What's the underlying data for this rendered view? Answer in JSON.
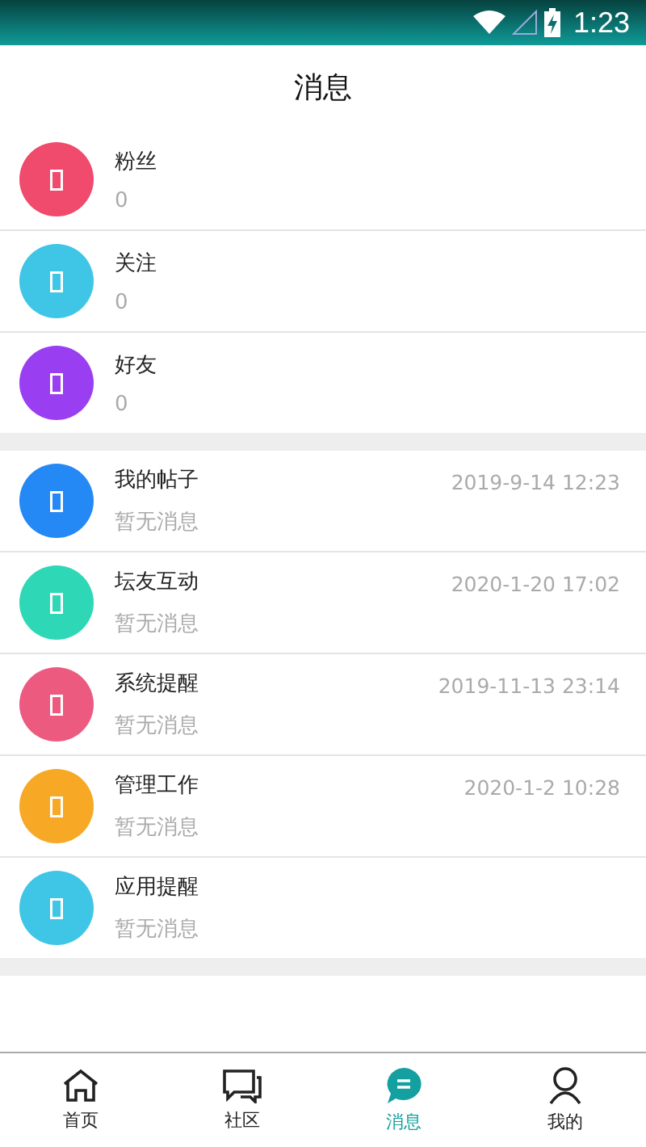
{
  "status_bar": {
    "time": "1:23"
  },
  "header": {
    "title": "消息"
  },
  "groups": [
    {
      "items": [
        {
          "title": "粉丝",
          "subtitle": "0",
          "color": "#f04a6c"
        },
        {
          "title": "关注",
          "subtitle": "0",
          "color": "#3fc6e6"
        },
        {
          "title": "好友",
          "subtitle": "0",
          "color": "#9a3ef2"
        }
      ]
    },
    {
      "items": [
        {
          "title": "我的帖子",
          "subtitle": "暂无消息",
          "time": "2019-9-14 12:23",
          "color": "#2488f5"
        },
        {
          "title": "坛友互动",
          "subtitle": "暂无消息",
          "time": "2020-1-20 17:02",
          "color": "#2ed8b6"
        },
        {
          "title": "系统提醒",
          "subtitle": "暂无消息",
          "time": "2019-11-13 23:14",
          "color": "#ec5a80"
        },
        {
          "title": "管理工作",
          "subtitle": "暂无消息",
          "time": "2020-1-2 10:28",
          "color": "#f7a825"
        },
        {
          "title": "应用提醒",
          "subtitle": "暂无消息",
          "color": "#3fc6e6"
        }
      ]
    }
  ],
  "tab_bar": [
    {
      "label": "首页",
      "selected": false
    },
    {
      "label": "社区",
      "selected": false
    },
    {
      "label": "消息",
      "selected": true
    },
    {
      "label": "我的",
      "selected": false
    }
  ]
}
